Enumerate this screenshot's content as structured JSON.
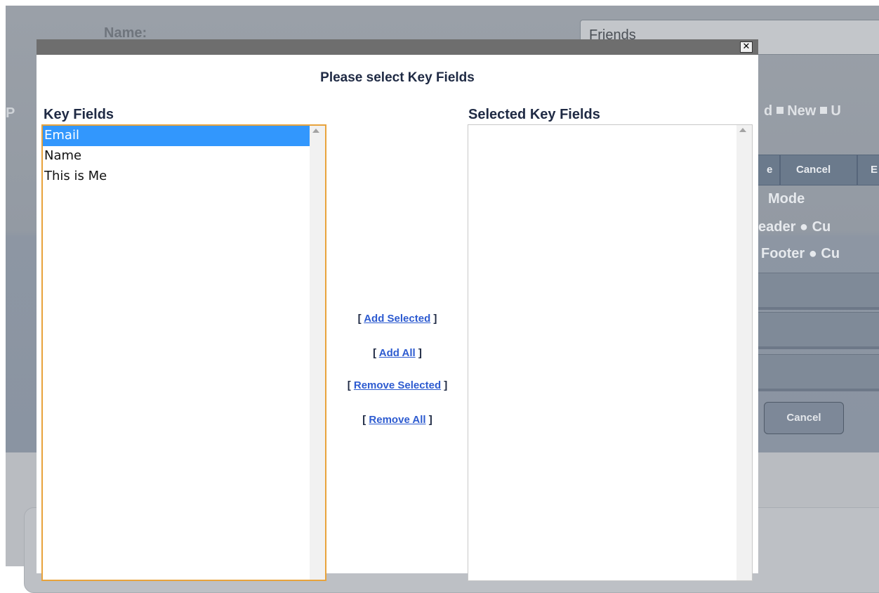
{
  "background": {
    "name_label": "Name:",
    "name_value": "Friends",
    "partial_label": "P",
    "legend": [
      "d",
      "New",
      "U"
    ],
    "toolbar": [
      "e",
      "Cancel",
      "E"
    ],
    "radio_lines": [
      "Mode",
      "eader  ●  Cu",
      "Footer  ●  Cu"
    ],
    "cancel_button": "Cancel"
  },
  "modal": {
    "close_glyph": "✕",
    "heading": "Please select Key Fields",
    "key_fields_label": "Key Fields",
    "selected_key_fields_label": "Selected Key Fields",
    "key_fields": [
      {
        "label": "Email",
        "selected": true
      },
      {
        "label": "Name",
        "selected": false
      },
      {
        "label": "This is Me",
        "selected": false
      }
    ],
    "selected_key_fields": [],
    "actions": {
      "add_selected": "Add Selected",
      "add_all": "Add All",
      "remove_selected": "Remove Selected",
      "remove_all": "Remove All",
      "open_bracket": "[",
      "close_bracket": "]"
    }
  },
  "colors": {
    "selection": "#3297fd",
    "link": "#2d5bd0",
    "heading": "#1f2a44",
    "focus_border": "#e8a33c"
  }
}
